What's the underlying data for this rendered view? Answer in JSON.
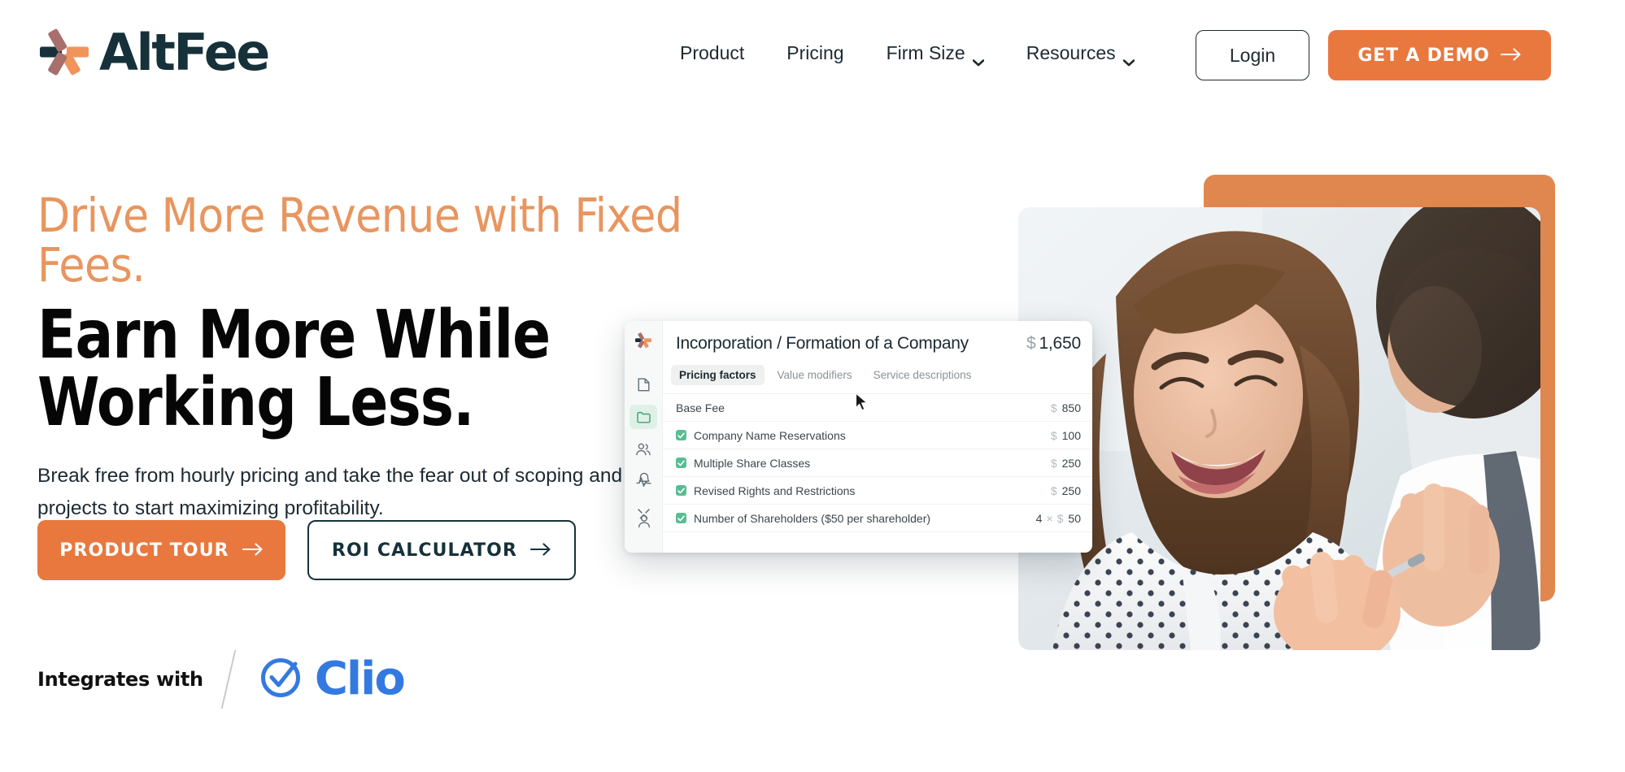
{
  "brand": {
    "name": "AltFee",
    "logo_icon": "altfee-asterisk-logo",
    "colors": {
      "navy": "#16313a",
      "orange": "#e8783e",
      "orange_soft": "#e0874f",
      "eyebrow": "#e8955f",
      "clio_blue": "#3479e0",
      "check_green": "#58bd94"
    }
  },
  "header": {
    "nav": [
      {
        "label": "Product",
        "has_dropdown": false
      },
      {
        "label": "Pricing",
        "has_dropdown": false
      },
      {
        "label": "Firm Size",
        "has_dropdown": true
      },
      {
        "label": "Resources",
        "has_dropdown": true
      }
    ],
    "login_label": "Login",
    "demo_label": "GET A DEMO",
    "demo_arrow": "arrow-right-icon"
  },
  "hero": {
    "eyebrow": "Drive More Revenue with Fixed Fees.",
    "headline_line1": "Earn More While",
    "headline_line2": "Working Less.",
    "subcopy": "Break free from hourly pricing and take the fear out of scoping and pricing client projects to start maximizing profitability.",
    "cta_primary": "PRODUCT TOUR",
    "cta_secondary": "ROI CALCULATOR",
    "integrates_label": "Integrates with",
    "integration_partner": "Clio",
    "integration_icon": "clio-check-circle-icon"
  },
  "app_mockup": {
    "rail_icons": [
      "altfee-logo-icon",
      "document-icon",
      "folder-icon",
      "people-icon",
      "activity-icon",
      "tools-icon",
      "bell-icon",
      "user-icon"
    ],
    "rail_active_index": 2,
    "title": "Incorporation / Formation of a Company",
    "total_currency": "$",
    "total": "1,650",
    "tabs": [
      {
        "label": "Pricing factors",
        "active": true
      },
      {
        "label": "Value modifiers",
        "active": false
      },
      {
        "label": "Service descriptions",
        "active": false
      }
    ],
    "rows": [
      {
        "label": "Base Fee",
        "checked": false,
        "currency": "$",
        "amount": "850",
        "qty": "",
        "has_qty": false
      },
      {
        "label": "Company Name Reservations",
        "checked": true,
        "currency": "$",
        "amount": "100",
        "qty": "",
        "has_qty": false
      },
      {
        "label": "Multiple Share Classes",
        "checked": true,
        "currency": "$",
        "amount": "250",
        "qty": "",
        "has_qty": false
      },
      {
        "label": "Revised Rights and Restrictions",
        "checked": true,
        "currency": "$",
        "amount": "250",
        "qty": "",
        "has_qty": false
      },
      {
        "label": "Number of Shareholders ($50 per shareholder)",
        "checked": true,
        "currency": "$",
        "amount": "50",
        "qty": "4",
        "has_qty": true
      }
    ],
    "cursor_icon": "mouse-pointer-icon"
  }
}
